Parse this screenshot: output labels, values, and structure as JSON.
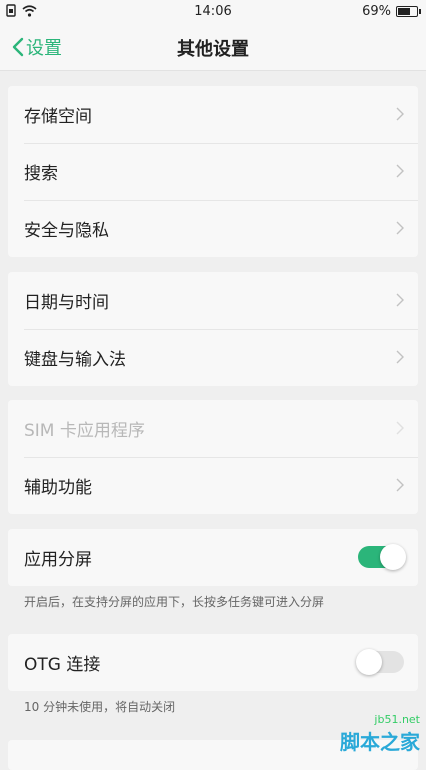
{
  "status_bar": {
    "time": "14:06",
    "battery_percent": "69%",
    "battery_level": 0.69
  },
  "nav": {
    "back_label": "设置",
    "title": "其他设置"
  },
  "groups": {
    "g1": {
      "items": [
        {
          "label": "存储空间"
        },
        {
          "label": "搜索"
        },
        {
          "label": "安全与隐私"
        }
      ]
    },
    "g2": {
      "items": [
        {
          "label": "日期与时间"
        },
        {
          "label": "键盘与输入法"
        }
      ]
    },
    "g3": {
      "items": [
        {
          "label": "SIM 卡应用程序",
          "disabled": true
        },
        {
          "label": "辅助功能"
        }
      ]
    }
  },
  "split_screen": {
    "label": "应用分屏",
    "enabled": true,
    "description": "开启后，在支持分屏的应用下，长按多任务键可进入分屏"
  },
  "otg": {
    "label": "OTG 连接",
    "enabled": false,
    "description": "10 分钟未使用，将自动关闭"
  },
  "watermark": {
    "url": "jb51.net",
    "name": "脚本之家"
  },
  "colors": {
    "accent": "#2bb57a",
    "background": "#efefef",
    "card": "#f8f8f8"
  }
}
